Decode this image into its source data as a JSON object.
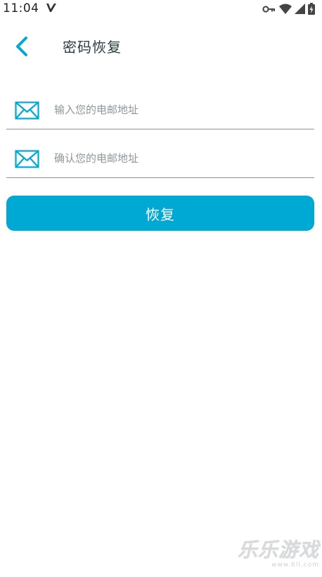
{
  "status_bar": {
    "time": "11:04",
    "icons": [
      "v-logo-icon",
      "key-icon",
      "wifi-icon",
      "signal-icon",
      "battery-charging-icon"
    ]
  },
  "header": {
    "title": "密码恢复",
    "back_icon": "chevron-left-icon"
  },
  "form": {
    "email_placeholder": "输入您的电邮地址",
    "email_value": "",
    "confirm_placeholder": "确认您的电邮地址",
    "confirm_value": "",
    "field_icon": "envelope-icon"
  },
  "actions": {
    "recover_label": "恢复"
  },
  "watermark": {
    "main": "乐乐游戏",
    "sub": "www.6ll.com"
  },
  "colors": {
    "accent": "#00a8d4",
    "title": "#2b3a42",
    "placeholder": "#8d979c",
    "divider": "#8a959b",
    "background": "#ffffff"
  }
}
